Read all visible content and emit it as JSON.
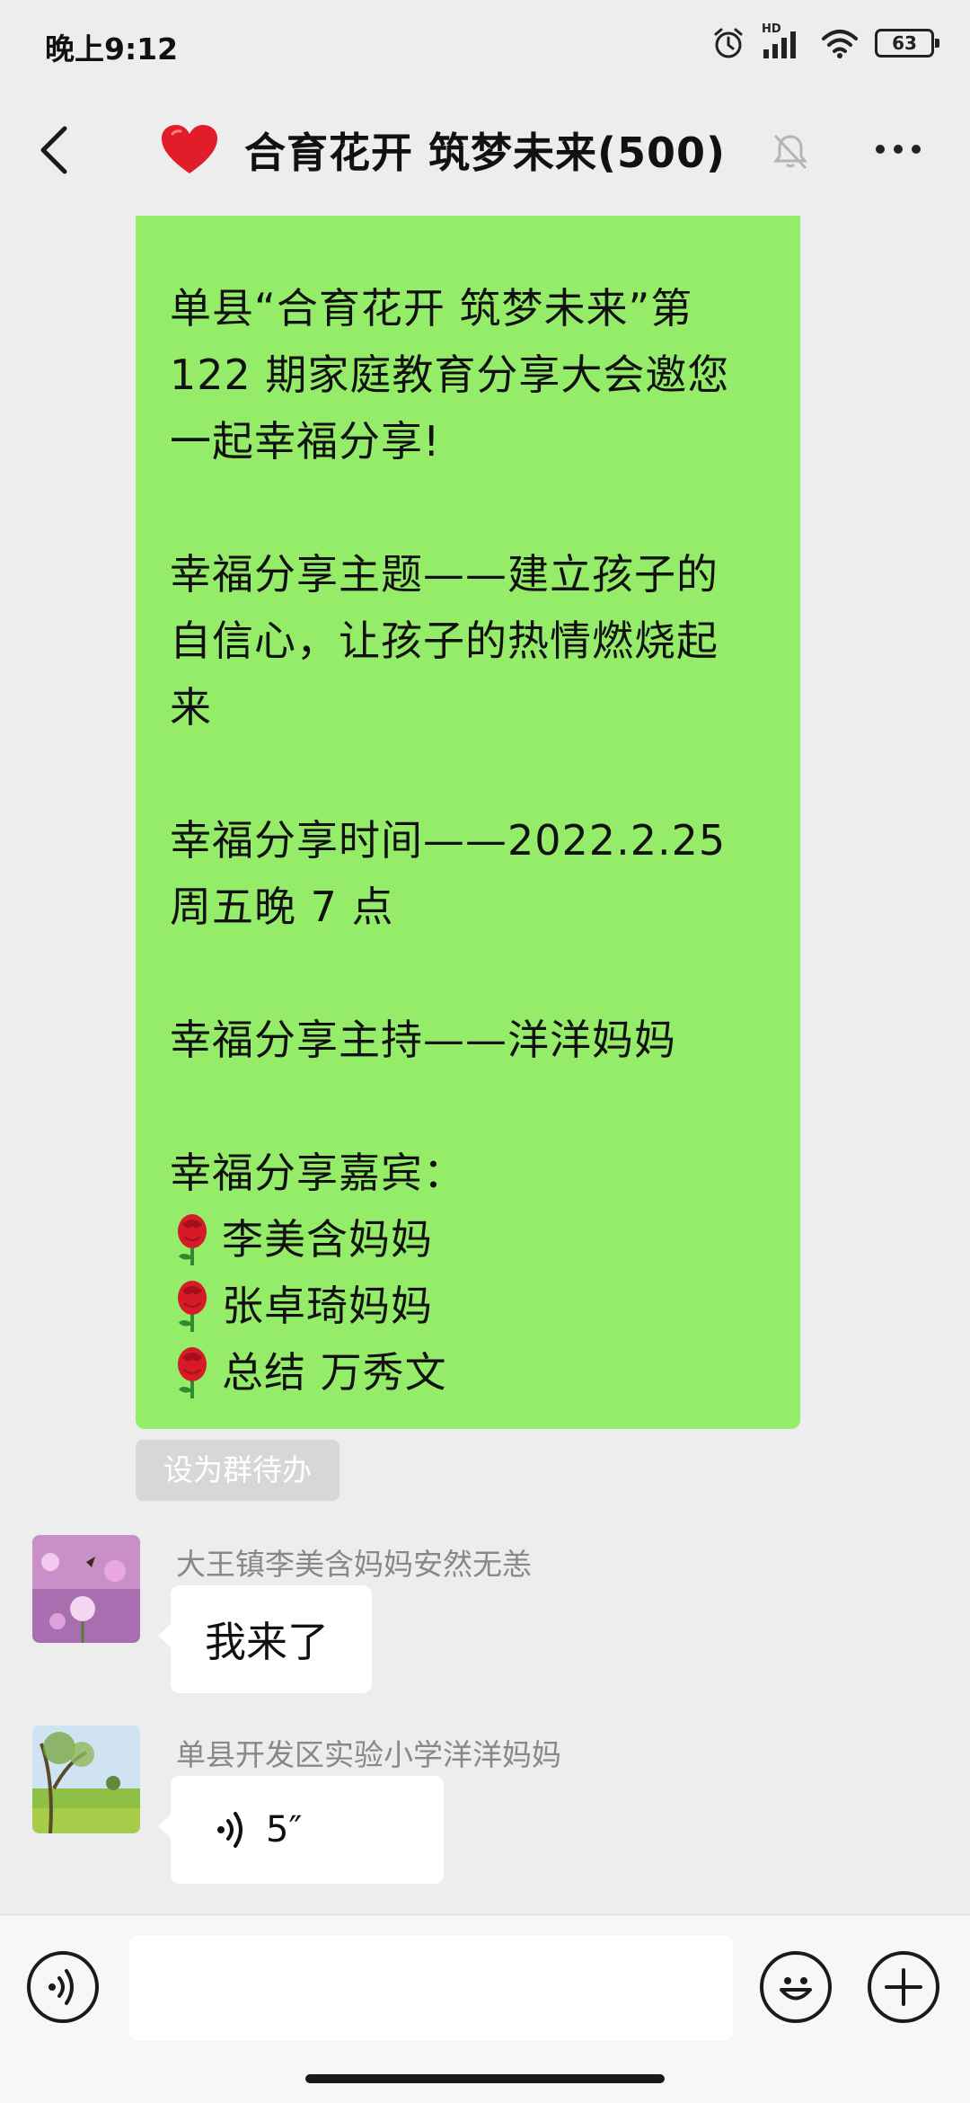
{
  "status_bar": {
    "time": "晚上9:12",
    "network_label": "HD",
    "battery_level": "63"
  },
  "header": {
    "title": "合育花开 筑梦未来(500)",
    "title_icon": "red-heart-icon",
    "muted": true
  },
  "messages": {
    "announcement": {
      "lines": [
        "单县“合育花开  筑梦未来”第",
        "122 期家庭教育分享大会邀您",
        "一起幸福分享!",
        "",
        "幸福分享主题——建立孩子的",
        "自信心，让孩子的热情燃烧起",
        "来",
        "",
        "幸福分享时间——2022.2.25",
        "周五晚 7 点",
        "",
        "幸福分享主持——洋洋妈妈",
        "",
        "幸福分享嘉宾："
      ],
      "guests": [
        "李美含妈妈",
        "张卓琦妈妈",
        "总结 万秀文"
      ],
      "guest_icon": "rose-icon",
      "bubble_color": "#95ec69"
    },
    "todo_button": "设为群待办",
    "msg1": {
      "sender": "大王镇李美含妈妈安然无恙",
      "text": "我来了"
    },
    "msg2": {
      "sender": "单县开发区实验小学洋洋妈妈",
      "voice_duration": "5″"
    }
  },
  "input_bar": {
    "placeholder": ""
  }
}
